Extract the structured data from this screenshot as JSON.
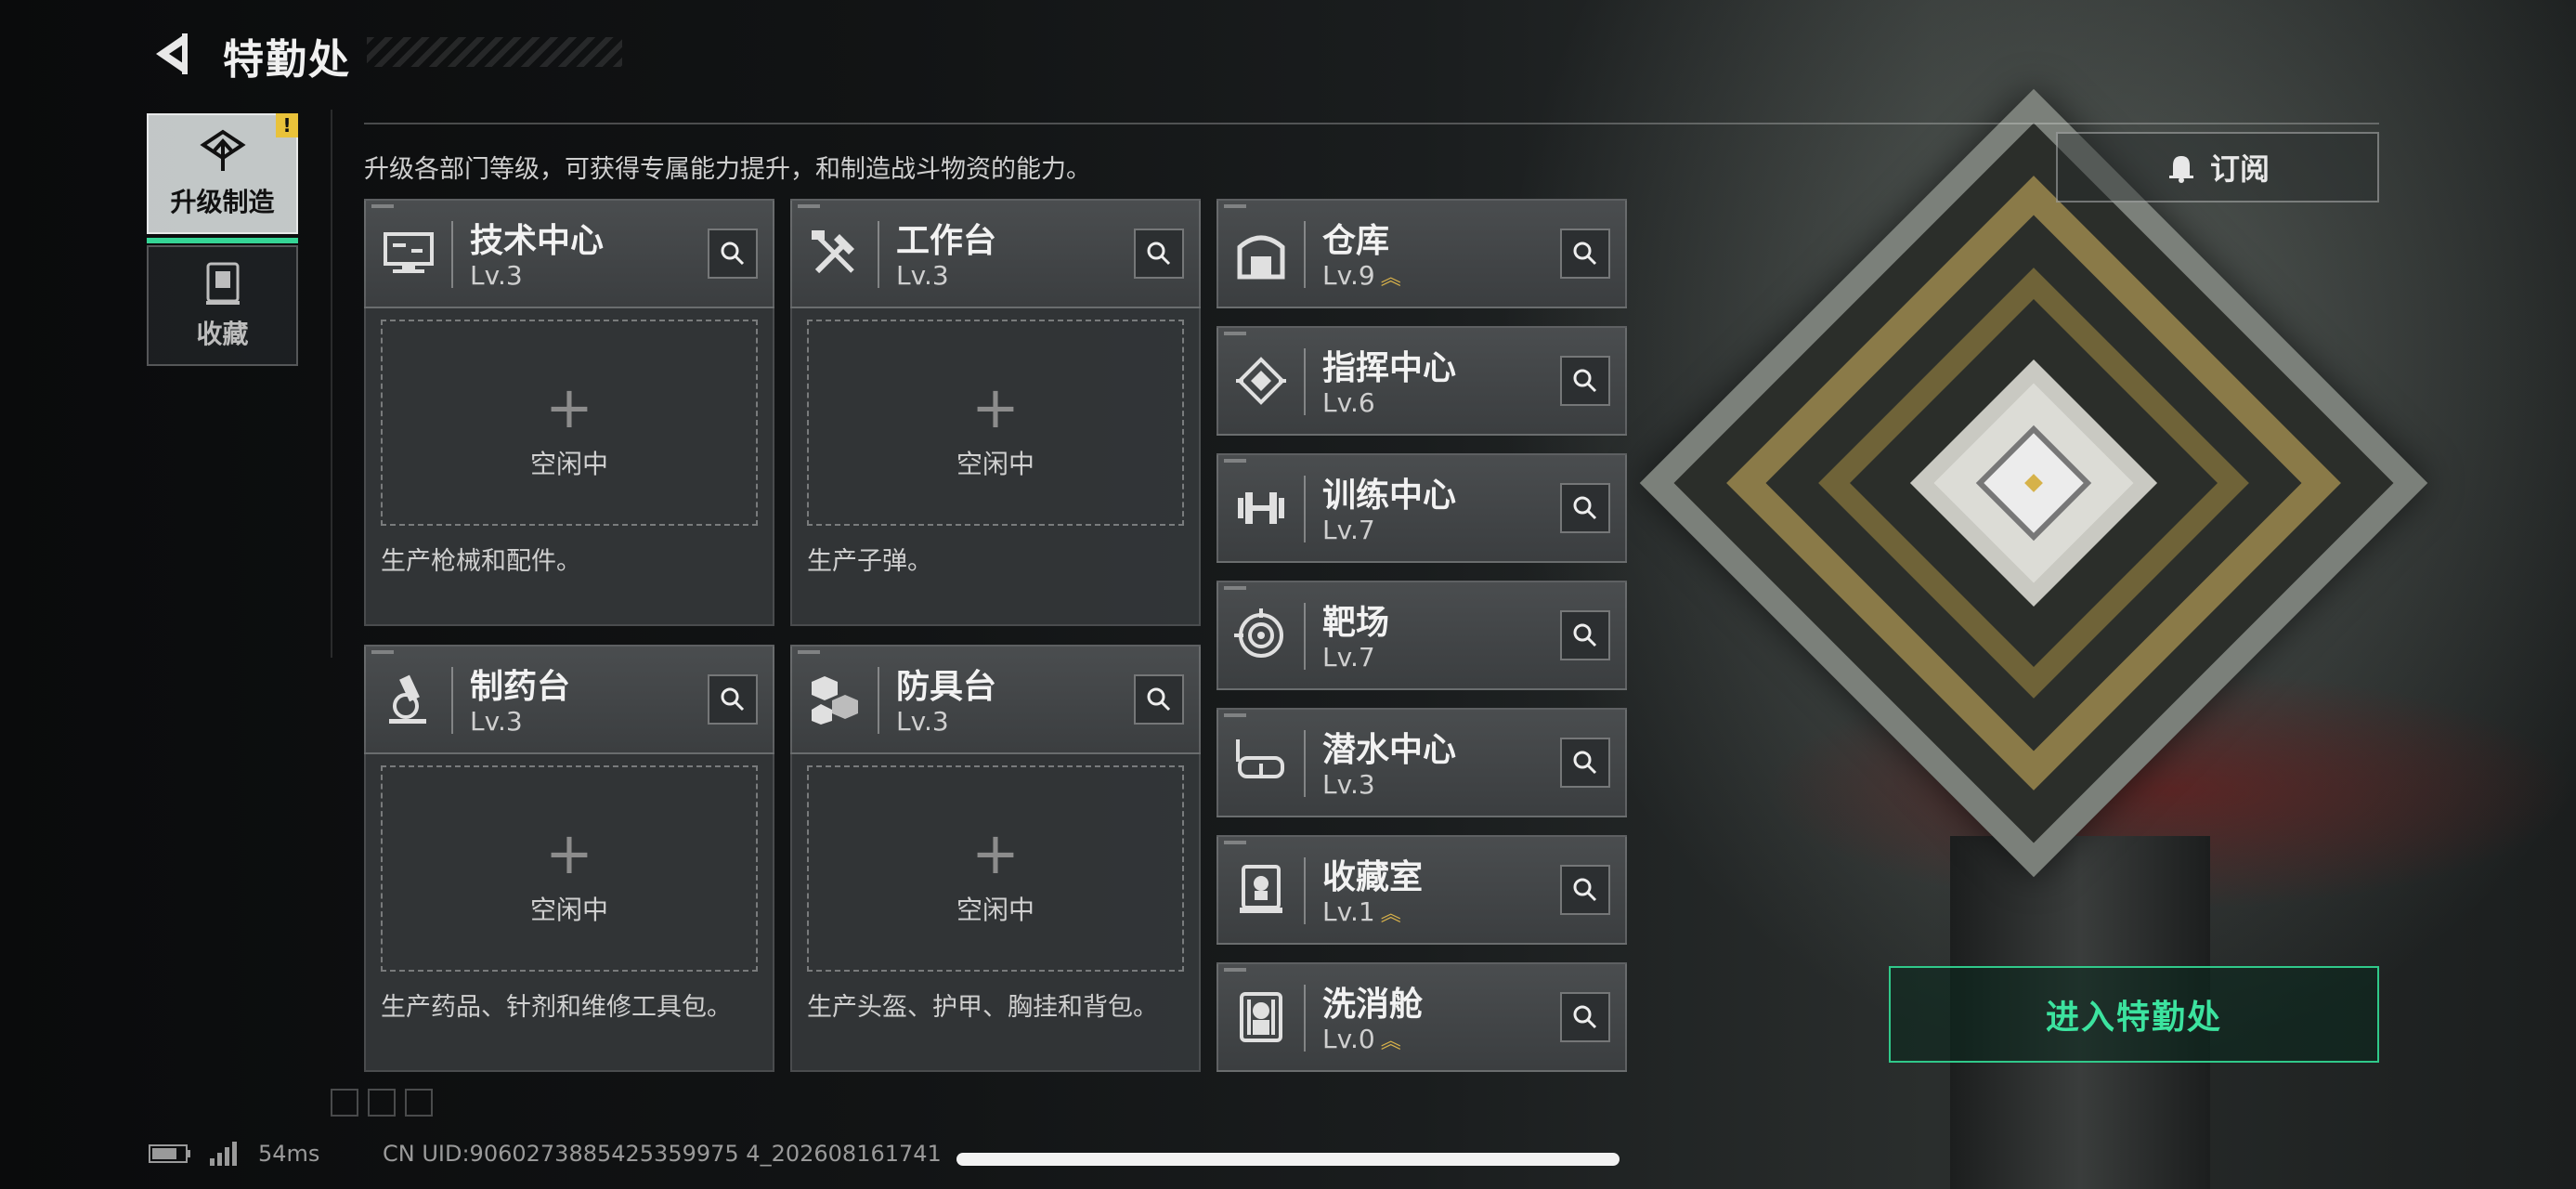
{
  "header": {
    "title": "特勤处"
  },
  "description": "升级各部门等级，可获得专属能力提升，和制造战斗物资的能力。",
  "tabs": [
    {
      "label": "升级制造",
      "active": true,
      "alert": "!"
    },
    {
      "label": "收藏",
      "active": false
    }
  ],
  "production": [
    {
      "name": "技术中心",
      "level": "Lv.3",
      "icon": "monitor-icon",
      "status": "空闲中",
      "note": "生产枪械和配件。"
    },
    {
      "name": "工作台",
      "level": "Lv.3",
      "icon": "tools-icon",
      "status": "空闲中",
      "note": "生产子弹。"
    },
    {
      "name": "制药台",
      "level": "Lv.3",
      "icon": "microscope-icon",
      "status": "空闲中",
      "note": "生产药品、针剂和维修工具包。"
    },
    {
      "name": "防具台",
      "level": "Lv.3",
      "icon": "armor-cubes-icon",
      "status": "空闲中",
      "note": "生产头盔、护甲、胸挂和背包。"
    }
  ],
  "facilities": [
    {
      "name": "仓库",
      "level": "Lv.9",
      "icon": "warehouse-icon",
      "upgrade": "︽"
    },
    {
      "name": "指挥中心",
      "level": "Lv.6",
      "icon": "chip-icon",
      "upgrade": ""
    },
    {
      "name": "训练中心",
      "level": "Lv.7",
      "icon": "dumbbell-icon",
      "upgrade": ""
    },
    {
      "name": "靶场",
      "level": "Lv.7",
      "icon": "target-icon",
      "upgrade": ""
    },
    {
      "name": "潜水中心",
      "level": "Lv.3",
      "icon": "diving-mask-icon",
      "upgrade": ""
    },
    {
      "name": "收藏室",
      "level": "Lv.1",
      "icon": "collection-icon",
      "upgrade": "︽"
    },
    {
      "name": "洗消舱",
      "level": "Lv.0",
      "icon": "decon-icon",
      "upgrade": "︽"
    }
  ],
  "buttons": {
    "subscribe": "订阅",
    "enter": "进入特勤处"
  },
  "footer": {
    "ping": "54ms",
    "uid": "CN UID:9060273885425359975 4_202608161741"
  },
  "colors": {
    "accent": "#3ce39f",
    "alert": "#e9c23a",
    "upgrade": "#d9b24a"
  }
}
